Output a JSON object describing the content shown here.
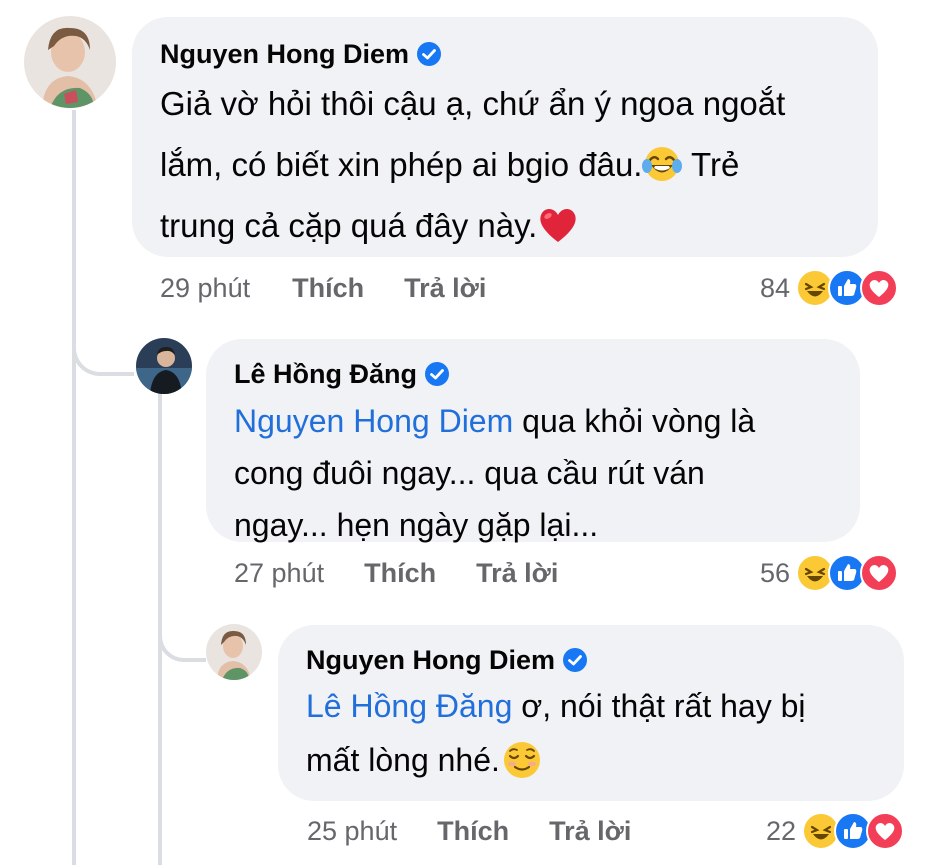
{
  "comments": [
    {
      "author": "Nguyen Hong Diem",
      "text_lines": [
        "Giả vờ hỏi thôi cậu ạ, chứ ẩn ý ngoa ngoắt",
        "lắm, có biết xin phép ai bgio đâu.",
        "trung cả cặp quá đây này."
      ],
      "text_after_emoji": " Trẻ",
      "inline_emoji": "laughing-tears",
      "end_emoji": "red-heart",
      "time": "29 phút",
      "like_label": "Thích",
      "reply_label": "Trả lời",
      "reaction_count": "84"
    },
    {
      "author": "Lê Hồng Đăng",
      "mention": "Nguyen Hong Diem",
      "text_lines": [
        " qua khỏi vòng là",
        "cong đuôi ngay... qua cầu rút ván",
        "ngay... hẹn ngày gặp lại..."
      ],
      "time": "27 phút",
      "like_label": "Thích",
      "reply_label": "Trả lời",
      "reaction_count": "56"
    },
    {
      "author": "Nguyen Hong Diem",
      "mention": "Lê Hồng Đăng",
      "text_lines": [
        " ơ, nói thật rất hay bị",
        "mất lòng nhé."
      ],
      "end_emoji": "relieved-face",
      "time": "25 phút",
      "like_label": "Thích",
      "reply_label": "Trả lời",
      "reaction_count": "22"
    }
  ],
  "reaction_icons": [
    "haha-icon",
    "like-icon",
    "love-icon"
  ],
  "colors": {
    "bubble": "#f0f2f5",
    "mention": "#216fdb",
    "meta": "#65676b",
    "verified": "#1877f2"
  }
}
